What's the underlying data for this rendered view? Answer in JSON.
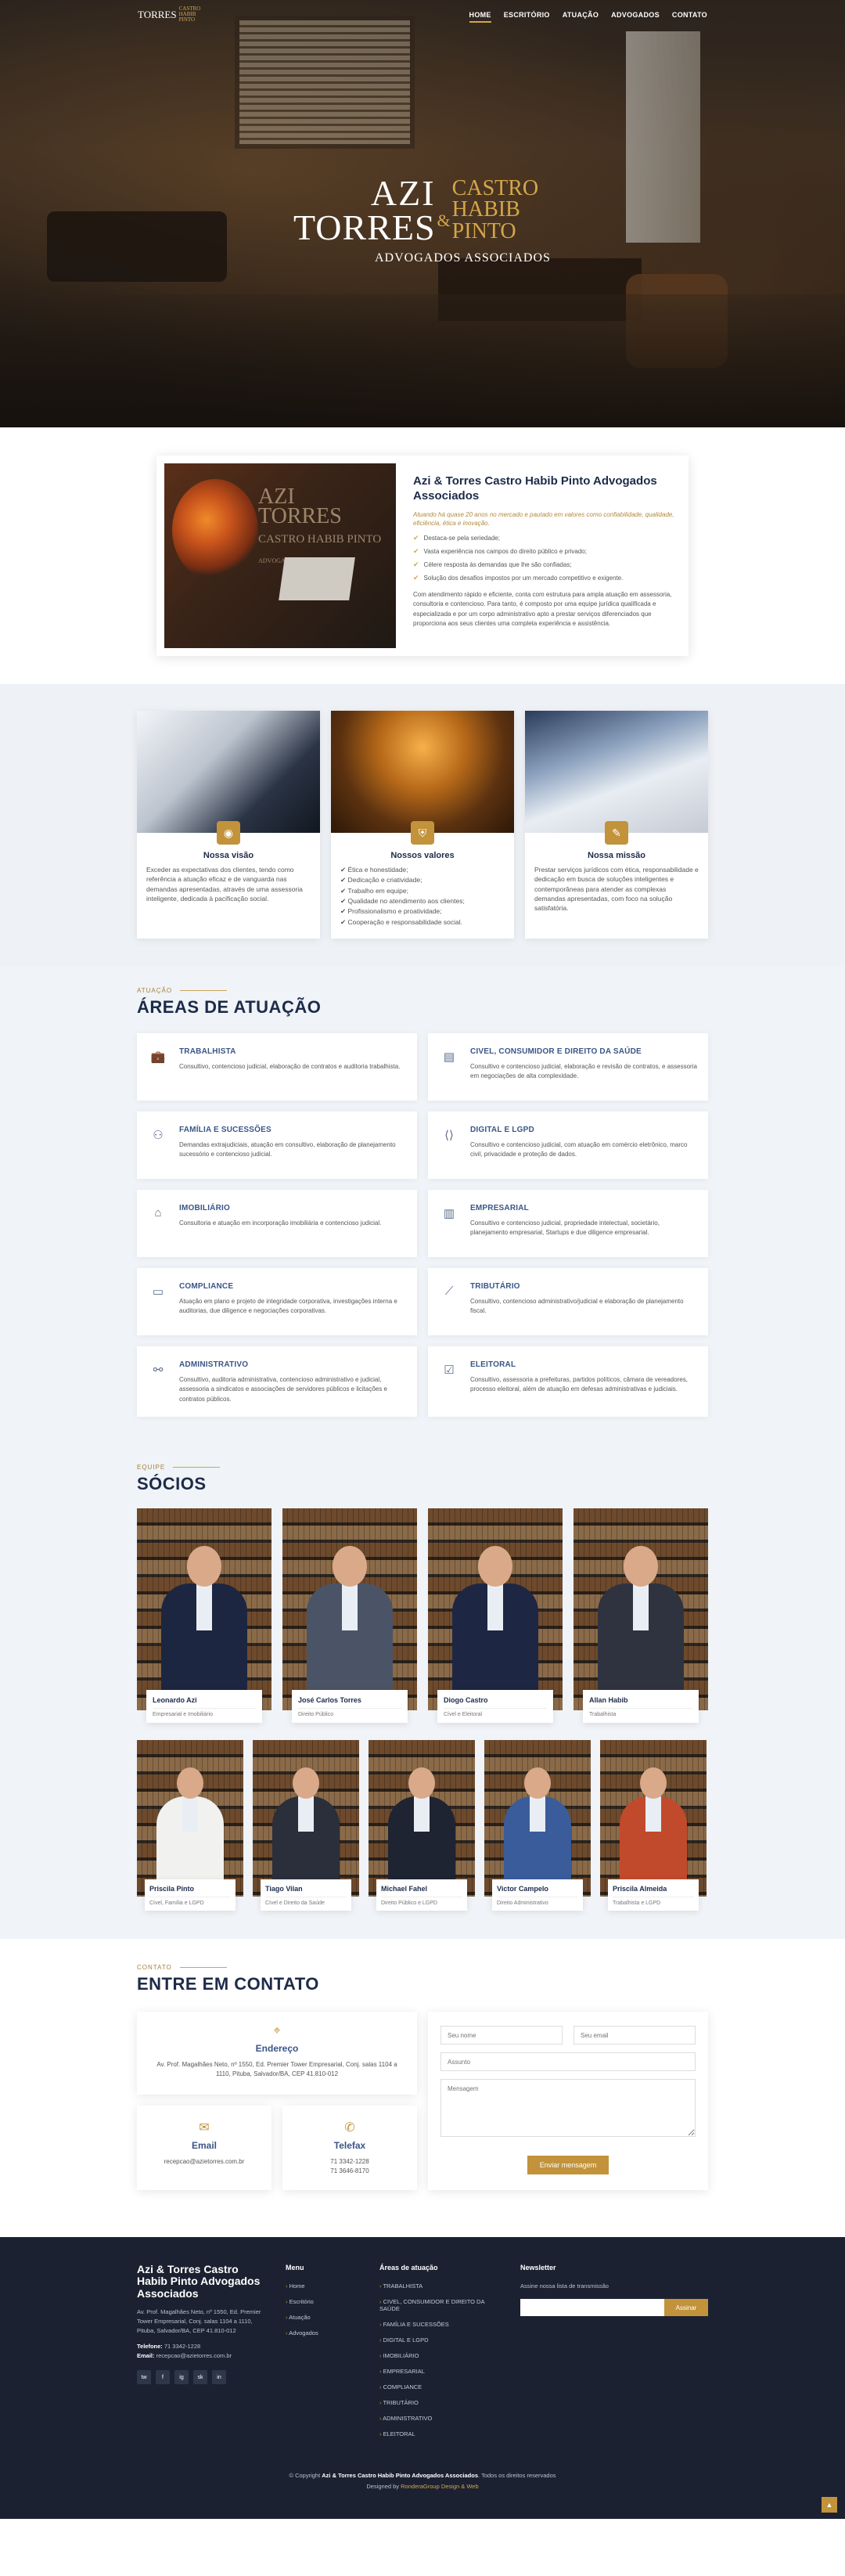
{
  "nav": {
    "logo_left": "TORRES",
    "logo_right": "CASTRO HABIB PINTO",
    "items": [
      "HOME",
      "ESCRITÓRIO",
      "ATUAÇÃO",
      "ADVOGADOS",
      "CONTATO"
    ]
  },
  "hero": {
    "logo_azi": "AZI",
    "logo_torres": "TORRES",
    "logo_amp": "&",
    "logo_castro": "CASTRO",
    "logo_habib": "HABIB",
    "logo_pinto": "PINTO",
    "logo_sub": "ADVOGADOS ASSOCIADOS"
  },
  "about": {
    "image_text_1": "AZI",
    "image_text_2": "TORRES",
    "image_text_3": "CASTRO HABIB PINTO",
    "image_text_4": "ADVOGADOS ASSOCIADOS",
    "title": "Azi & Torres Castro Habib Pinto Advogados Associados",
    "lead": "Atuando há quase 20 anos no mercado e pautado em valores como confiabilidade, qualidade, eficiência, ética e inovação.",
    "items": [
      "Destaca-se pela seriedade;",
      "Vasta experiência nos campos do direito público e privado;",
      "Célere resposta às demandas que lhe são confiadas;",
      "Solução dos desafios impostos por um mercado competitivo e exigente."
    ],
    "text": "Com atendimento rápido e eficiente, conta com estrutura para ampla atuação em assessoria, consultoria e contencioso. Para tanto, é composto por uma equipe jurídica qualificada e especializada e por um corpo administrativo apto a prestar serviços diferenciados que proporciona aos seus clientes uma completa experiência e assistência."
  },
  "values": [
    {
      "title": "Nossa visão",
      "icon": "eye-icon",
      "text": "Exceder as expectativas dos clientes, tendo como referência a atuação eficaz e de vanguarda nas demandas apresentadas, através de uma assessoria inteligente, dedicada à pacificação social."
    },
    {
      "title": "Nossos valores",
      "icon": "shield-icon",
      "items": [
        "Ética e honestidade;",
        "Dedicação e criatividade;",
        "Trabalho em equipe;",
        "Qualidade no atendimento aos clientes;",
        "Profissionalismo e proatividade;",
        "Cooperação e responsabilidade social."
      ]
    },
    {
      "title": "Nossa missão",
      "icon": "pen-icon",
      "text": "Prestar serviços jurídicos com ética, responsabilidade e dedicação em busca de soluções inteligentes e contemporâneas para atender as complexas demandas apresentadas, com foco na solução satisfatória."
    }
  ],
  "areas": {
    "tag": "ATUAÇÃO",
    "title": "ÁREAS DE ATUAÇÃO",
    "items": [
      {
        "title": "TRABALHISTA",
        "icon": "briefcase-icon",
        "text": "Consultivo, contencioso judicial, elaboração de contratos e auditoria trabalhista."
      },
      {
        "title": "CIVEL, CONSUMIDOR E DIREITO DA SAÚDE",
        "icon": "document-icon",
        "text": "Consultivo e contencioso judicial, elaboração e revisão de contratos, e assessoria em negociações de alta complexidade."
      },
      {
        "title": "FAMÍLIA E SUCESSÕES",
        "icon": "family-icon",
        "text": "Demandas extrajudiciais, atuação em consultivo, elaboração de planejamento sucessório e contencioso judicial."
      },
      {
        "title": "DIGITAL E LGPD",
        "icon": "code-icon",
        "text": "Consultivo e contencioso judicial, com atuação em comércio eletrônico, marco civil, privacidade e proteção de dados."
      },
      {
        "title": "IMOBILIÁRIO",
        "icon": "house-icon",
        "text": "Consultoria e atuação em incorporação imobiliária e contencioso judicial."
      },
      {
        "title": "EMPRESARIAL",
        "icon": "building-icon",
        "text": "Consultivo e contencioso judicial, propriedade intelectual, societário, planejamento empresarial, Startups e due diligence empresarial."
      },
      {
        "title": "COMPLIANCE",
        "icon": "card-icon",
        "text": "Atuação em plano e projeto de integridade corporativa, investigações interna e auditorias, due diligence e negociações corporativas."
      },
      {
        "title": "TRIBUTÁRIO",
        "icon": "chart-icon",
        "text": "Consultivo, contencioso administrativo/judicial e elaboração de planejamento fiscal."
      },
      {
        "title": "ADMINISTRATIVO",
        "icon": "network-icon",
        "text": "Consultivo, auditoria administrativa, contencioso administrativo e judicial, assessoria a sindicatos e associações de servidores públicos e licitações e contratos públicos."
      },
      {
        "title": "ELEITORAL",
        "icon": "ballot-icon",
        "text": "Consultivo, assessoria a prefeituras, partidos políticos, câmara de vereadores, processo eleitoral, além de atuação em defesas administrativas e judiciais."
      }
    ]
  },
  "team": {
    "tag": "EQUIPE",
    "title": "SÓCIOS",
    "partners": [
      {
        "name": "Leonardo Azi",
        "role": "Empresarial e Imobiliário",
        "suit": "#1c2640",
        "tie": "#8e2a2a"
      },
      {
        "name": "José Carlos Torres",
        "role": "Direito Público",
        "suit": "#4a5466",
        "tie": "#5c6b85"
      },
      {
        "name": "Diogo Castro",
        "role": "Cível e Eleitoral",
        "suit": "#1d2744",
        "tie": "#2f3f66"
      },
      {
        "name": "Allan Habib",
        "role": "Trabalhista",
        "suit": "#2f3340",
        "tie": "#49516a"
      }
    ],
    "associates": [
      {
        "name": "Priscila Pinto",
        "role": "Cível, Família e LGPD",
        "suit": "#f1f1ef",
        "tie": "#e0dcd3"
      },
      {
        "name": "Tiago Vilan",
        "role": "Cível e Direito da Saúde",
        "suit": "#2a2f3b",
        "tie": "#505a70"
      },
      {
        "name": "Michael Fahel",
        "role": "Direito Público e LGPD",
        "suit": "#1f2433",
        "tie": "#3e465c"
      },
      {
        "name": "Victor Campelo",
        "role": "Direito Administrativo",
        "suit": "#3a5c9a",
        "tie": "#2b3f66"
      },
      {
        "name": "Priscila Almeida",
        "role": "Trabalhista e LGPD",
        "suit": "#c24a2c",
        "tie": "#1f2433"
      }
    ]
  },
  "contact": {
    "tag": "CONTATO",
    "title": "ENTRE EM CONTATO",
    "address_title": "Endereço",
    "address": "Av. Prof. Magalhães Neto, nº 1550, Ed. Premier Tower Empresarial, Conj. salas 1104 a 1110, Pituba, Salvador/BA, CEP 41.810-012",
    "email_title": "Email",
    "email": "recepcao@azietorres.com.br",
    "phone_title": "Telefax",
    "phone1": "71 3342-1228",
    "phone2": "71 3646-8170",
    "form": {
      "name": "Seu nome",
      "email": "Seu email",
      "subject": "Assunto",
      "message": "Mensagem",
      "submit": "Enviar mensagem"
    }
  },
  "footer": {
    "brand": "Azi & Torres Castro Habib Pinto Advogados Associados",
    "address": "Av. Prof. Magalhães Neto, nº 1550, Ed. Premier Tower Empresarial, Conj. salas 1104 a 1110, Pituba, Salvador/BA, CEP 41.810-012",
    "phone_label": "Telefone:",
    "phone": "71 3342-1228",
    "email_label": "Email:",
    "email": "recepcao@azietorres.com.br",
    "social": [
      "tw",
      "f",
      "ig",
      "sk",
      "in"
    ],
    "menu_title": "Menu",
    "menu": [
      "Home",
      "Escritório",
      "Atuação",
      "Advogados"
    ],
    "areas_title": "Áreas de atuação",
    "areas": [
      "TRABALHISTA",
      "CIVEL, CONSUMIDOR E DIREITO DA SAÚDE",
      "FAMÍLIA E SUCESSÕES",
      "DIGITAL E LGPD",
      "IMOBILIÁRIO",
      "EMPRESARIAL",
      "COMPLIANCE",
      "TRIBUTÁRIO",
      "ADMINISTRATIVO",
      "ELEITORAL"
    ],
    "newsletter_title": "Newsletter",
    "newsletter_text": "Assine nossa lista de transmissão",
    "newsletter_btn": "Assinar",
    "copy_pre": "© Copyright",
    "copy_brand": "Azi & Torres Castro Habib Pinto Advogados Associados",
    "copy_post": ". Todos os direitos reservados",
    "designed_pre": "Designed by",
    "designed_by": "RonderaGroup Design & Web",
    "to_top": "▲"
  }
}
